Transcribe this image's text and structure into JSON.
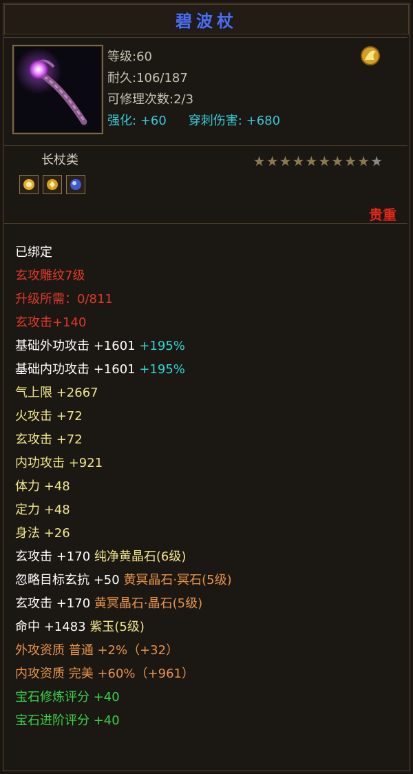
{
  "title": "碧波杖",
  "stats": {
    "level": "等级:60",
    "durability": "耐久:106/187",
    "repair": "可修理次数:2/3",
    "enhance_label": "强化:",
    "enhance_value": "+60",
    "pierce_label": "穿刺伤害:",
    "pierce_value": "+680"
  },
  "weapon_type": "长杖类",
  "rarity": "贵重",
  "stars": {
    "filled": 9,
    "total": 10
  },
  "colors": {
    "title": "#4f6fe6",
    "cyan": "#38c8d8",
    "red": "#e03a2a",
    "yellow": "#f0e68c",
    "orange": "#e8944a",
    "green": "#3ad24a",
    "white": "#ffffff"
  },
  "attributes": [
    {
      "segments": [
        {
          "text": "已绑定",
          "color": "white"
        }
      ]
    },
    {
      "segments": [
        {
          "text": "玄攻雕纹7级",
          "color": "red"
        }
      ]
    },
    {
      "segments": [
        {
          "text": "升级所需：0/811",
          "color": "red"
        }
      ]
    },
    {
      "segments": [
        {
          "text": "玄攻击+140",
          "color": "red"
        }
      ]
    },
    {
      "segments": [
        {
          "text": "基础外功攻击 +1601 ",
          "color": "white"
        },
        {
          "text": "+195%",
          "color": "c-cyan"
        }
      ]
    },
    {
      "segments": [
        {
          "text": "基础内功攻击 +1601 ",
          "color": "white"
        },
        {
          "text": "+195%",
          "color": "c-cyan"
        }
      ]
    },
    {
      "segments": [
        {
          "text": "气上限 +2667",
          "color": "yellow"
        }
      ]
    },
    {
      "segments": [
        {
          "text": "火攻击 +72",
          "color": "yellow"
        }
      ]
    },
    {
      "segments": [
        {
          "text": "玄攻击 +72",
          "color": "yellow"
        }
      ]
    },
    {
      "segments": [
        {
          "text": "内功攻击 +921",
          "color": "yellow"
        }
      ]
    },
    {
      "segments": [
        {
          "text": "体力 +48",
          "color": "yellow"
        }
      ]
    },
    {
      "segments": [
        {
          "text": "定力 +48",
          "color": "yellow"
        }
      ]
    },
    {
      "segments": [
        {
          "text": "身法 +26",
          "color": "yellow"
        }
      ]
    },
    {
      "segments": [
        {
          "text": "玄攻击 +170 ",
          "color": "white"
        },
        {
          "text": "纯净黄晶石(6级)",
          "color": "yellow"
        }
      ]
    },
    {
      "segments": [
        {
          "text": "忽略目标玄抗 +50 ",
          "color": "white"
        },
        {
          "text": "黄冥晶石·冥石(5级)",
          "color": "orange"
        }
      ]
    },
    {
      "segments": [
        {
          "text": "玄攻击 +170 ",
          "color": "white"
        },
        {
          "text": "黄冥晶石·晶石(5级)",
          "color": "orange"
        }
      ]
    },
    {
      "segments": [
        {
          "text": "命中 +1483 ",
          "color": "white"
        },
        {
          "text": "紫玉(5级)",
          "color": "yellow"
        }
      ]
    },
    {
      "segments": [
        {
          "text": "外攻资质  普通 +2%（+32）",
          "color": "orange"
        }
      ]
    },
    {
      "segments": [
        {
          "text": "内攻资质  完美 +60%（+961）",
          "color": "orange"
        }
      ]
    },
    {
      "segments": [
        {
          "text": "宝石修炼评分 +40",
          "color": "green"
        }
      ]
    },
    {
      "segments": [
        {
          "text": "宝石进阶评分 +40",
          "color": "green"
        }
      ]
    }
  ],
  "icons": {
    "weapon": "staff-icon",
    "badge": "gold-emblem-icon",
    "gems": [
      "gold-gem-icon",
      "gold-gem-icon",
      "blue-gem-icon"
    ]
  }
}
